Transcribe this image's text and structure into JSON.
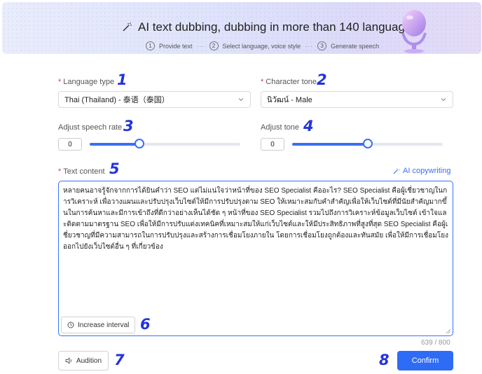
{
  "banner": {
    "title": "AI text dubbing, dubbing in more than 140 languages",
    "steps": [
      {
        "num": "1",
        "label": "Provide text"
      },
      {
        "num": "2",
        "label": "Select language, voice style"
      },
      {
        "num": "3",
        "label": "Generate speech"
      }
    ],
    "step_separator": "···"
  },
  "form": {
    "language": {
      "label": "Language type",
      "value": "Thai (Thailand) - 泰语（泰国）"
    },
    "tone": {
      "label": "Character tone",
      "value": "นิวัฒน์ - Male"
    },
    "speech_rate": {
      "label": "Adjust speech rate",
      "value": "0",
      "level": 0.33
    },
    "adjust_tone": {
      "label": "Adjust tone",
      "value": "0",
      "level": 0.5
    },
    "text_content": {
      "label": "Text content",
      "ai_copywriting": "AI copywriting",
      "text": "หลายคนอาจรู้จักจากการได้ยินคำว่า SEO แต่ไม่แน่ใจว่าหน้าที่ของ SEO Specialist คืออะไร? SEO Specialist คือผู้เชี่ยวชาญในการวิเคราะห์ เพื่อวางแผนและปรับปรุงเว็บไซต์ให้มีการปรับปรุงตาม SEO ให้เหมาะสมกับคำสำคัญเพื่อให้เว็บไซต์ที่มีนัยสำคัญมากขึ้นในการค้นหาและมีการเข้าถึงที่ดีกว่าอย่างเห็นได้ชัด ๆ หน้าที่ของ SEO Specialist รวมไปถึงการวิเคราะห์ข้อมูลเว็บไซต์ เข้าใจและติดตามมาตรฐาน SEO เพื่อให้มีการปรับแต่งเทคนิคที่เหมาะสมให้แก่เว็บไซต์และให้มีประสิทธิภาพที่สูงที่สุด SEO Specialist คือผู้เชี่ยวชาญที่มีความสามารถในการปรับปรุงและสร้างการเชื่อมโยงภายใน โดยการเชื่อมโยงถูกต้องและทันสมัย เพื่อให้มีการเชื่อมโยงออกไปยังเว็บไซต์อื่น ๆ ที่เกี่ยวข้อง",
      "increase_interval": "Increase interval",
      "counter": "639 / 800"
    }
  },
  "actions": {
    "audition": "Audition",
    "confirm": "Confirm"
  },
  "badges": [
    "1",
    "2",
    "3",
    "4",
    "5",
    "6",
    "7",
    "8"
  ],
  "colors": {
    "accent": "#2f6cf5",
    "required": "#e0393e",
    "badge": "#2233dd"
  },
  "icons": {
    "banner": "magic-wand-icon",
    "ai": "magic-wand-icon",
    "interval": "clock-icon",
    "audition": "speaker-icon",
    "dropdown": "chevron-down-icon"
  }
}
